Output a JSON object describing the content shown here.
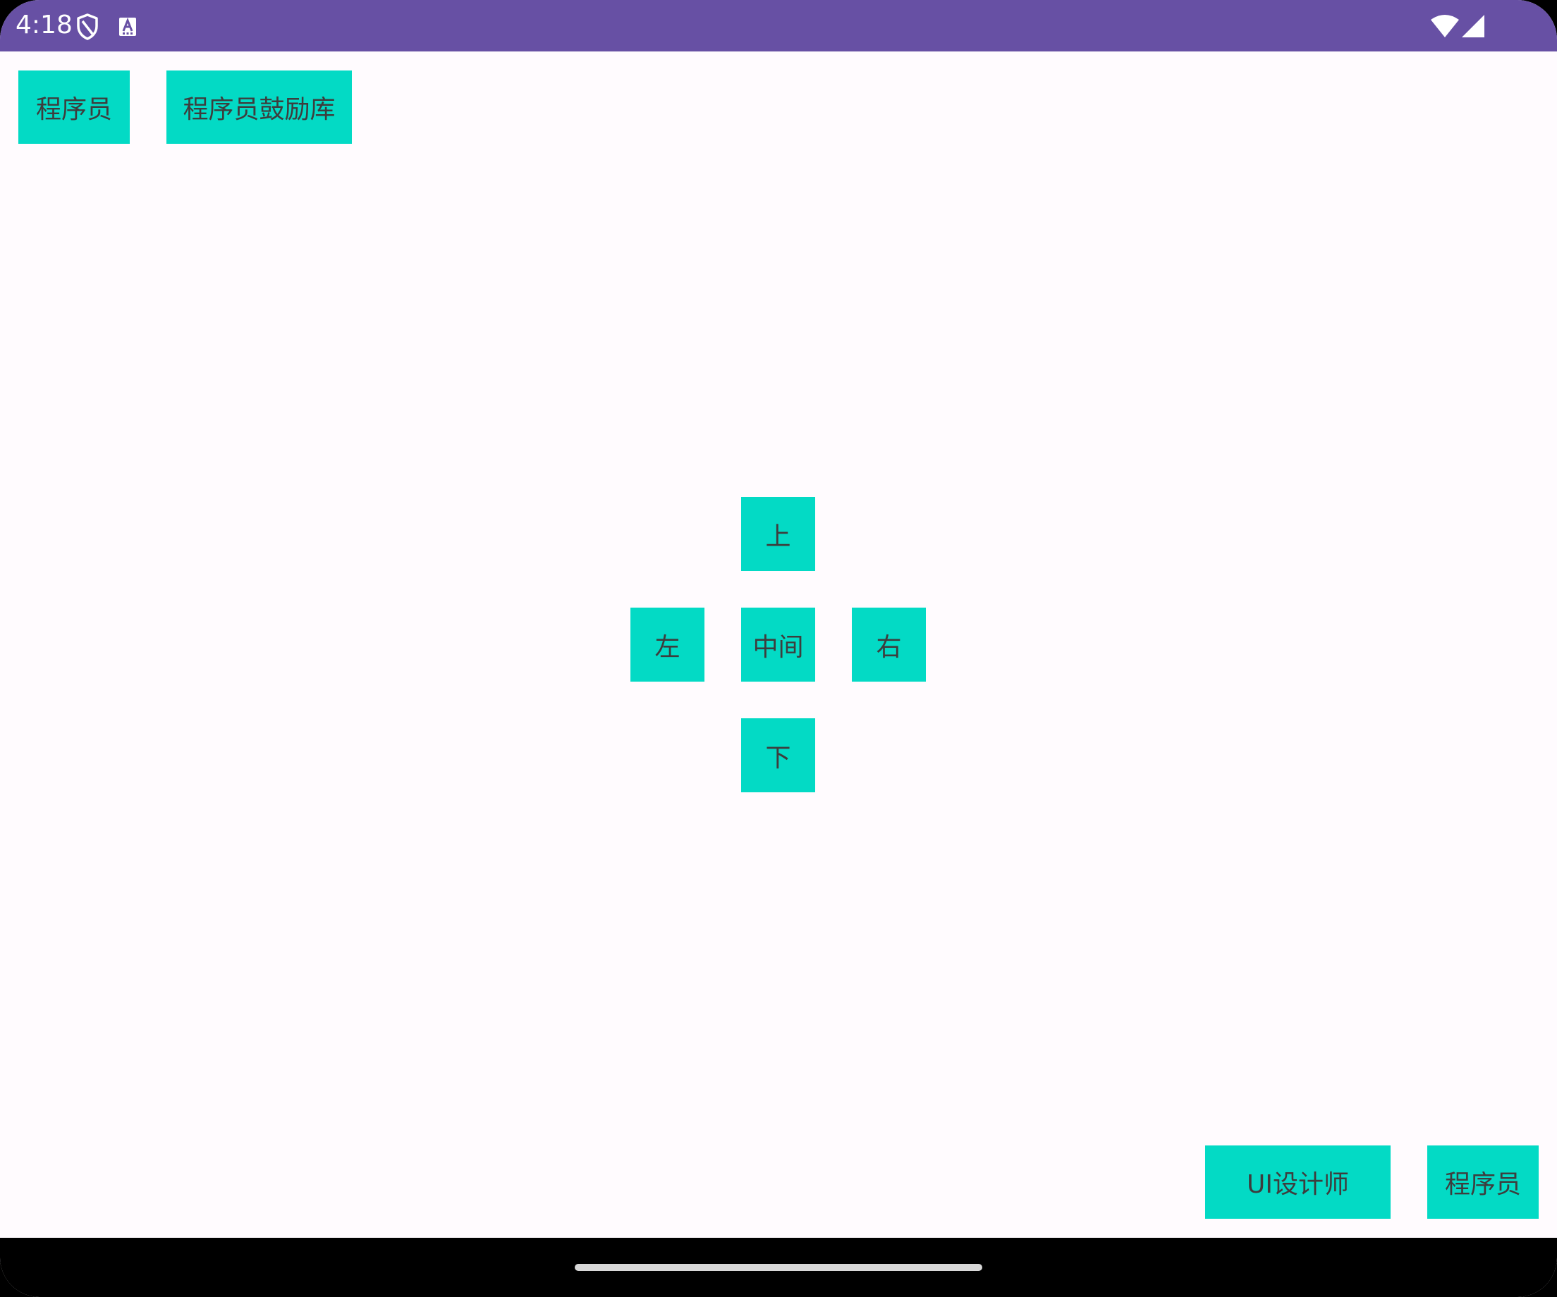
{
  "status_bar": {
    "time": "4:18",
    "icons": [
      "shield-icon",
      "keyboard-a-icon",
      "wifi-icon",
      "cell-signal-icon"
    ],
    "color": "#6750a4"
  },
  "buttons": {
    "top_left": "程序员",
    "top_second": "程序员鼓励库",
    "up": "上",
    "left": "左",
    "center": "中间",
    "right": "右",
    "down": "下",
    "bottom_ui_designer": "UI设计师",
    "bottom_right": "程序员"
  },
  "colors": {
    "button_bg": "#03dac5",
    "button_text": "#3d3d3d",
    "background": "#fffbfe"
  }
}
